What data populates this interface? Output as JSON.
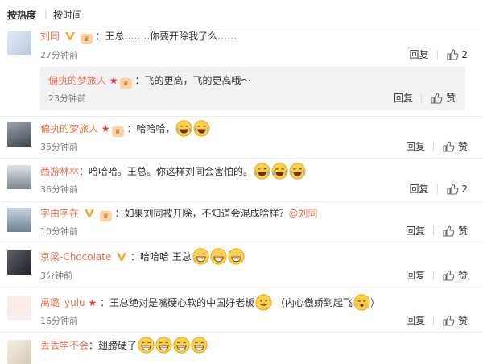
{
  "sort": {
    "hot": "按热度",
    "time": "按时间",
    "sep": "|"
  },
  "labels": {
    "reply": "回复",
    "like": "赞"
  },
  "colors": {
    "username": "#eb7350",
    "vip": "#f5a623",
    "time": "#808080"
  },
  "comments": [
    {
      "user": "刘同",
      "text": "：王总……..你要开除我了么……",
      "time": "27分钟前",
      "likes": "2",
      "reply": {
        "user": "偏执的梦旅人",
        "text": "：飞的更高，飞的更高哦～",
        "time": "23分钟前",
        "likes": "赞"
      }
    },
    {
      "user": "偏执的梦旅人",
      "text": "：哈哈哈，",
      "time": "35分钟前",
      "likes": "赞"
    },
    {
      "user": "西游林林",
      "text": "：哈哈哈。王总。你这样刘同会害怕的。",
      "time": "36分钟前",
      "likes": "2"
    },
    {
      "user": "字由字在",
      "text": "：如果刘同被开除，不知道会混成啥样？",
      "mention": "@刘同",
      "time": "10分钟前",
      "likes": "赞"
    },
    {
      "user": "京梁-Chocolate",
      "text": "：哈哈哈 王总",
      "time": "3分钟前",
      "likes": "赞"
    },
    {
      "user": "禹璐_yulu",
      "text": "：王总绝对是嘴硬心软的中国好老板",
      "text2": "（内心傲娇到起飞",
      "text3": "）",
      "time": "16分钟前",
      "likes": "赞"
    },
    {
      "user": "丢丢学不会",
      "text": "：翅膀硬了"
    }
  ]
}
